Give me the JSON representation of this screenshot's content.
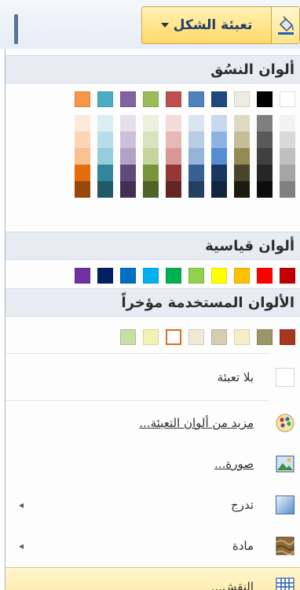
{
  "button": {
    "label": "تعبئة الشكل",
    "icon": "paint-bucket-icon"
  },
  "sections": {
    "theme": "ألوان النسُق",
    "standard": "ألوان قياسية",
    "recent": "الألوان المستخدمة مؤخراً"
  },
  "theme_colors": [
    {
      "base": "#ffffff",
      "shades": [
        "#f2f2f2",
        "#d9d9d9",
        "#bfbfbf",
        "#a6a6a6",
        "#808080"
      ]
    },
    {
      "base": "#000000",
      "shades": [
        "#7f7f7f",
        "#595959",
        "#404040",
        "#262626",
        "#0d0d0d"
      ]
    },
    {
      "base": "#eeece1",
      "shades": [
        "#ddd9c3",
        "#c4bd97",
        "#948a54",
        "#4a452a",
        "#1d1b10"
      ]
    },
    {
      "base": "#1f497d",
      "shades": [
        "#c6d9f1",
        "#8db3e2",
        "#548dd4",
        "#17375e",
        "#0f243e"
      ]
    },
    {
      "base": "#4f81bd",
      "shades": [
        "#dbe5f1",
        "#b8cce4",
        "#95b3d7",
        "#366092",
        "#244061"
      ]
    },
    {
      "base": "#c0504d",
      "shades": [
        "#f2dcdb",
        "#e6b9b8",
        "#d99694",
        "#953735",
        "#632523"
      ]
    },
    {
      "base": "#9bbb59",
      "shades": [
        "#ebf1de",
        "#d7e4bd",
        "#c3d69b",
        "#77933c",
        "#4f6228"
      ]
    },
    {
      "base": "#8064a2",
      "shades": [
        "#e6e0ec",
        "#ccc1da",
        "#b3a2c7",
        "#604a7b",
        "#403152"
      ]
    },
    {
      "base": "#4bacc6",
      "shades": [
        "#dbeef4",
        "#b7dee8",
        "#93cddd",
        "#31859c",
        "#215968"
      ]
    },
    {
      "base": "#f79646",
      "shades": [
        "#fdeada",
        "#fbd5b5",
        "#fac08f",
        "#e46c0a",
        "#984807"
      ]
    }
  ],
  "standard_colors": [
    "#c00000",
    "#ff0000",
    "#ffc000",
    "#ffff00",
    "#92d050",
    "#00b050",
    "#00b0f0",
    "#0070c0",
    "#002060",
    "#7030a0"
  ],
  "recent_colors": [
    {
      "color": "#a5361f",
      "selected": false
    },
    {
      "color": "#9b9568",
      "selected": false
    },
    {
      "color": "#f4efc9",
      "selected": false
    },
    {
      "color": "#d6ccb0",
      "selected": false
    },
    {
      "color": "#efe9d8",
      "selected": false
    },
    {
      "color": "#ffffff",
      "selected": true
    },
    {
      "color": "#f3f2b4",
      "selected": false
    },
    {
      "color": "#c7dea5",
      "selected": false
    }
  ],
  "items": [
    {
      "label": "بلا تعبئة",
      "icon": "no-fill-box-icon",
      "underlined": false,
      "submenu": false
    },
    {
      "label": "مزيد من ألوان التعبئة...",
      "icon": "color-palette-icon",
      "underlined": true,
      "submenu": false
    },
    {
      "label": "صورة...",
      "icon": "picture-icon",
      "underlined": true,
      "submenu": false
    },
    {
      "label": "تدرج",
      "icon": "gradient-icon",
      "underlined": false,
      "submenu": true
    },
    {
      "label": "مادة",
      "icon": "texture-icon",
      "underlined": false,
      "submenu": true
    },
    {
      "label": "النقش...",
      "icon": "pattern-grid-icon",
      "underlined": false,
      "submenu": false
    }
  ],
  "submenu_arrow": "◂"
}
